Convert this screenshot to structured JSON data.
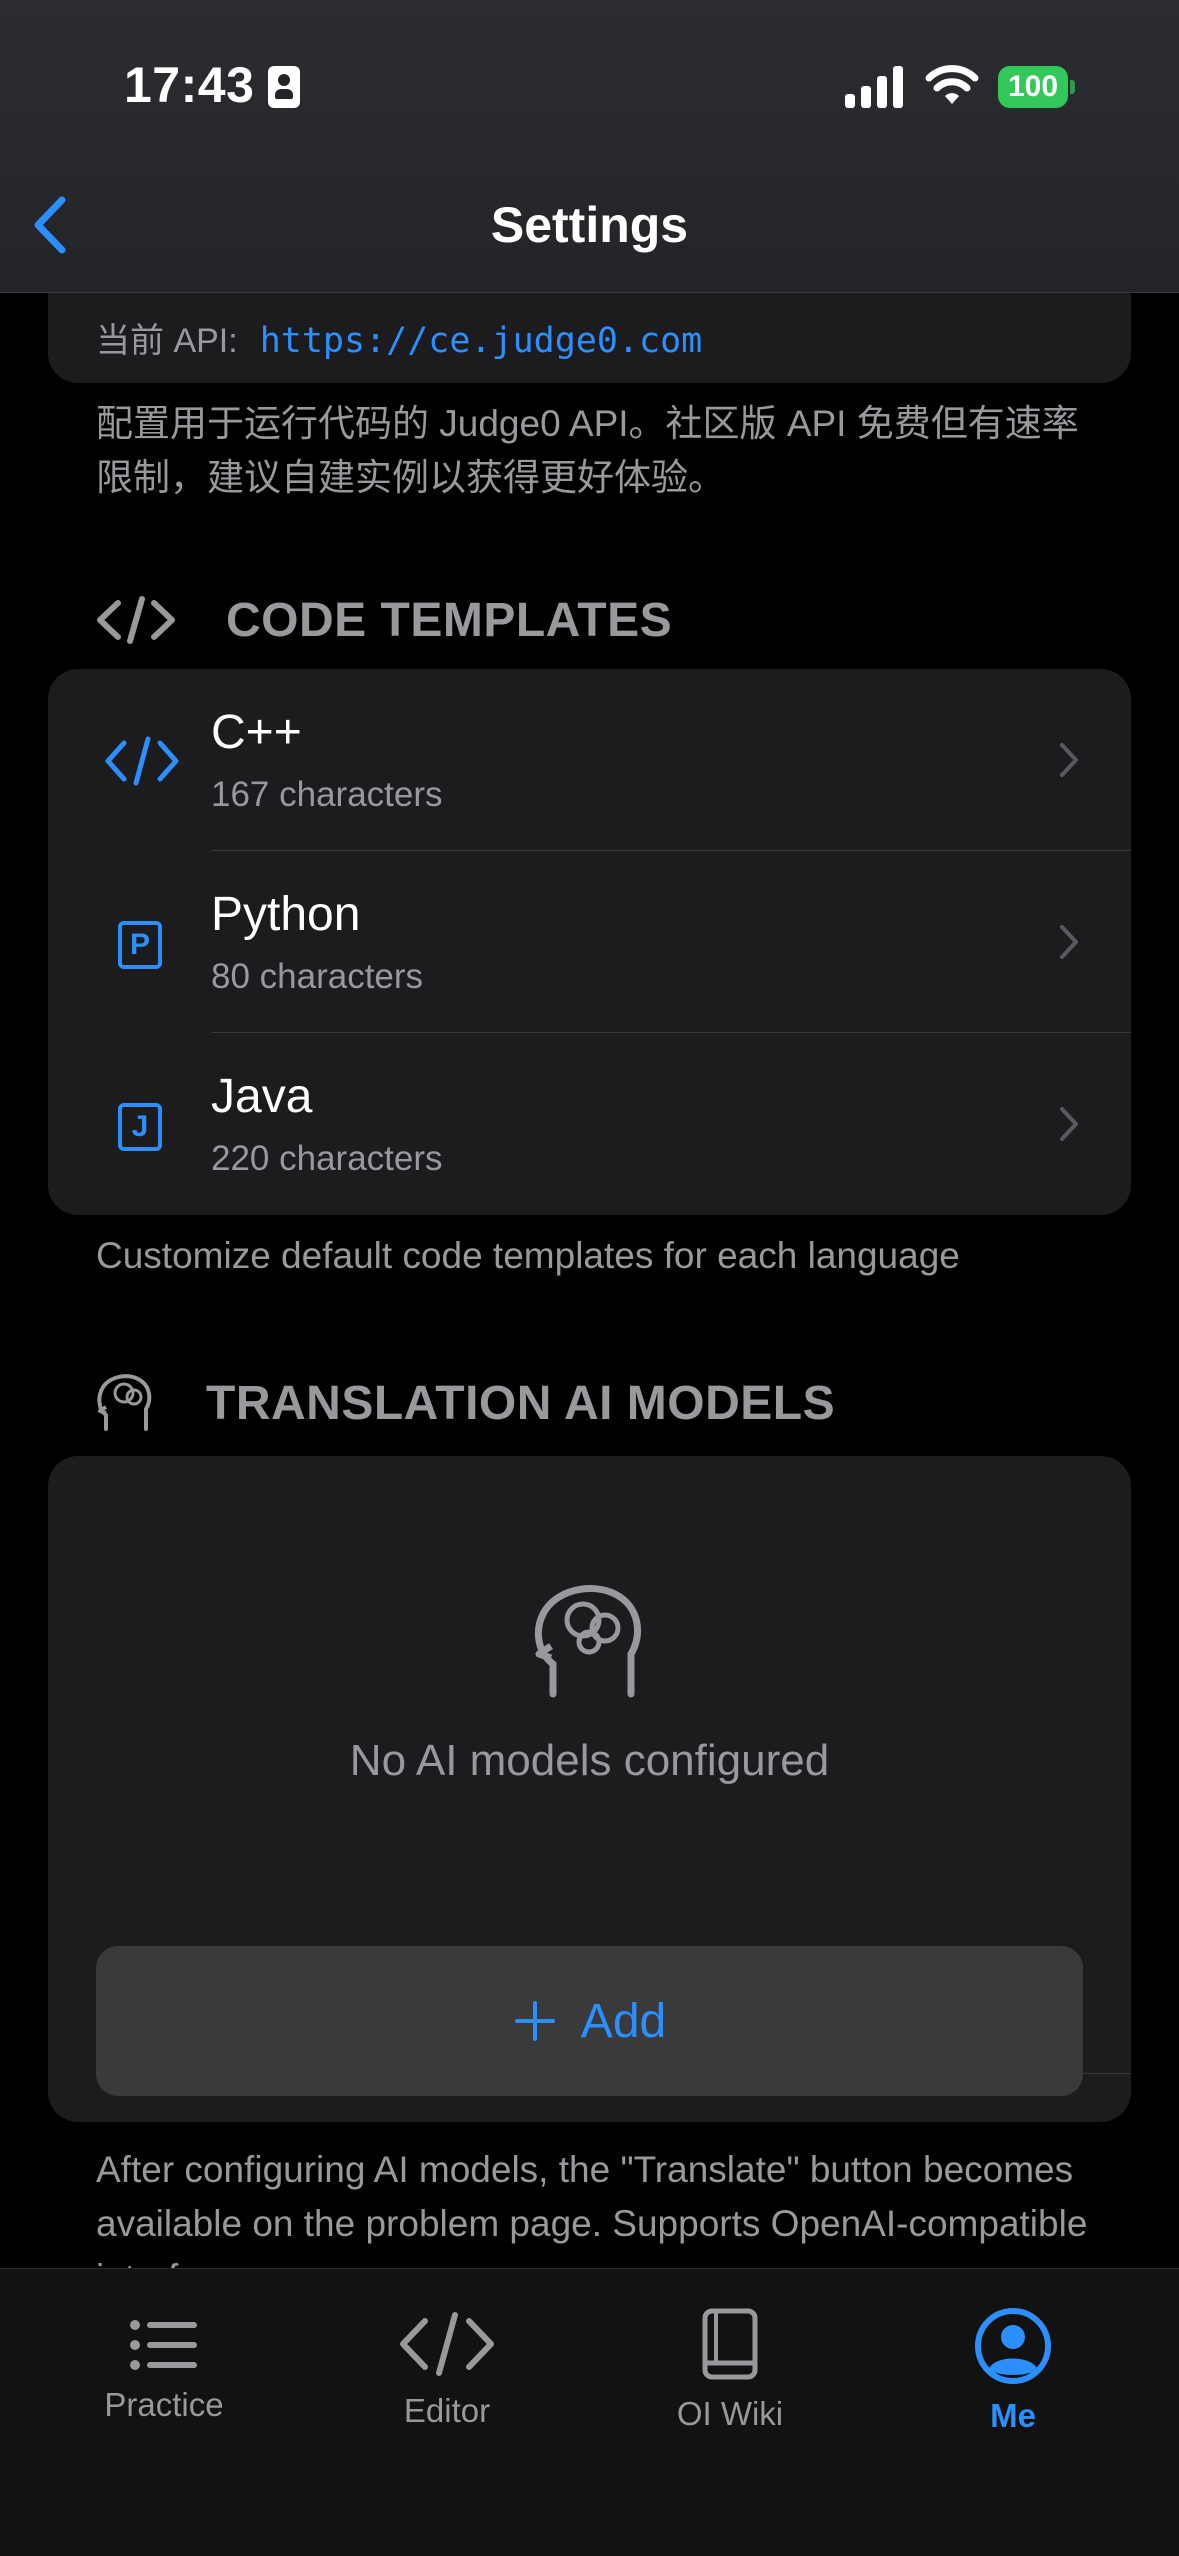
{
  "status": {
    "time": "17:43",
    "battery": "100"
  },
  "nav": {
    "title": "Settings"
  },
  "api": {
    "label": "当前 API:",
    "url": "https://ce.judge0.com",
    "footnote": "配置用于运行代码的 Judge0 API。社区版 API 免费但有速率限制，建议自建实例以获得更好体验。"
  },
  "templates": {
    "title": "CODE TEMPLATES",
    "items": [
      {
        "name": "C++",
        "sub": "167 characters",
        "icon": "code-brackets-icon"
      },
      {
        "name": "Python",
        "sub": "80 characters",
        "icon": "P"
      },
      {
        "name": "Java",
        "sub": "220 characters",
        "icon": "J"
      }
    ],
    "footnote": "Customize default code templates for each language"
  },
  "ai_models": {
    "title": "TRANSLATION AI MODELS",
    "empty_text": "No AI models configured",
    "add_label": "Add",
    "footnote": "After configuring AI models, the \"Translate\" button becomes available on the problem page. Supports OpenAI-compatible interfaces."
  },
  "tabs": [
    {
      "label": "Practice",
      "icon": "list-icon",
      "active": false
    },
    {
      "label": "Editor",
      "icon": "code-icon",
      "active": false
    },
    {
      "label": "OI Wiki",
      "icon": "book-icon",
      "active": false
    },
    {
      "label": "Me",
      "icon": "person-circle-icon",
      "active": true
    }
  ],
  "colors": {
    "accent": "#2b8fff",
    "background": "#000000",
    "card": "#1c1c1e",
    "secondary_text": "#98989d",
    "battery": "#34c759"
  }
}
